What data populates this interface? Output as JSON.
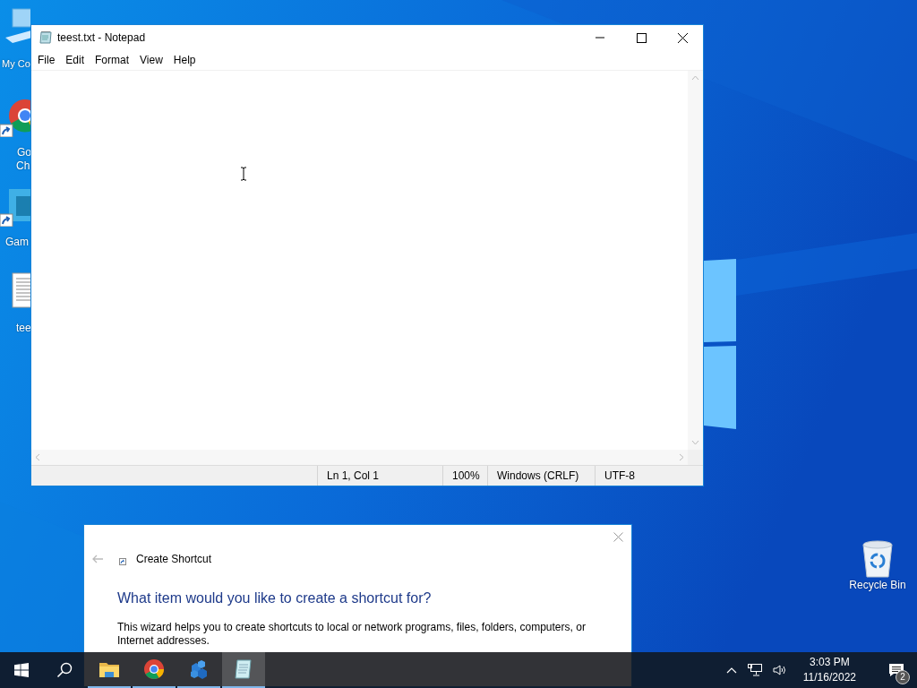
{
  "desktop": {
    "icons": [
      {
        "kind": "computer",
        "lines": [
          "My Co"
        ],
        "shortcut": false
      },
      {
        "kind": "chrome",
        "lines": [
          "Go",
          "Ch"
        ],
        "shortcut": true
      },
      {
        "kind": "game",
        "lines": [
          "Gam"
        ],
        "shortcut": true
      },
      {
        "kind": "textfile",
        "lines": [
          "tee"
        ],
        "shortcut": false
      },
      {
        "kind": "recycle",
        "lines": [
          "Recycle Bin"
        ],
        "shortcut": false
      }
    ]
  },
  "notepad": {
    "title": "teest.txt - Notepad",
    "menu": [
      "File",
      "Edit",
      "Format",
      "View",
      "Help"
    ],
    "status_bar": [
      "Ln 1, Col 1",
      "100%",
      "Windows (CRLF)",
      "UTF-8"
    ]
  },
  "dialog": {
    "title": "Create Shortcut",
    "back_disabled": true,
    "heading": "What item would you like to create a shortcut for?",
    "body": "This wizard helps you to create shortcuts to local or network programs, files, folders, computers, or Internet addresses."
  },
  "taskbar": {
    "apps": [
      {
        "kind": "folder",
        "running": true,
        "selected": false
      },
      {
        "kind": "chrome",
        "running": true,
        "selected": false
      },
      {
        "kind": "cubes",
        "running": true,
        "selected": false
      },
      {
        "kind": "notepad",
        "running": true,
        "selected": true
      }
    ],
    "time": "3:03 PM",
    "date": "11/16/2022",
    "notification_count": "2"
  }
}
